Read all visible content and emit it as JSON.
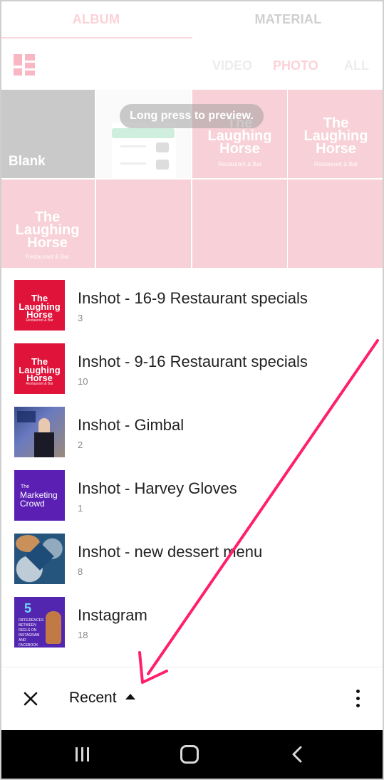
{
  "tabs": {
    "album": "ALBUM",
    "material": "MATERIAL"
  },
  "filters": {
    "video": "VIDEO",
    "photo": "PHOTO",
    "all": "ALL"
  },
  "grid": {
    "blank_label": "Blank",
    "preview_toast": "Long press to preview.",
    "horse_line1": "The",
    "horse_line2": "Laughing",
    "horse_line3": "Horse",
    "horse_sub": "Restaurant & Bar"
  },
  "albums": [
    {
      "name": "Inshot - 16-9 Restaurant specials",
      "count": "3"
    },
    {
      "name": "Inshot - 9-16 Restaurant specials",
      "count": "10"
    },
    {
      "name": "Inshot - Gimbal",
      "count": "2"
    },
    {
      "name": "Inshot - Harvey Gloves",
      "count": "1"
    },
    {
      "name": "Inshot - new dessert menu",
      "count": "8"
    },
    {
      "name": "Instagram",
      "count": "18"
    }
  ],
  "thumb_text": {
    "mkt_small": "The",
    "mkt_big1": "Marketing",
    "mkt_big2": "Crowd",
    "insta_five": "5",
    "insta_txt": "DIFFERENCES BETWEEN REELS ON INSTAGRAM AND FACEBOOK"
  },
  "bottom": {
    "selector_label": "Recent"
  },
  "colors": {
    "accent_pink": "#fbd2d9",
    "arrow": "#ff1f6b",
    "horse_red": "#e0133a"
  },
  "icons": [
    "close-icon",
    "caret-up-icon",
    "more-vert-icon",
    "grid-icon",
    "recents-icon",
    "home-icon",
    "back-icon"
  ]
}
